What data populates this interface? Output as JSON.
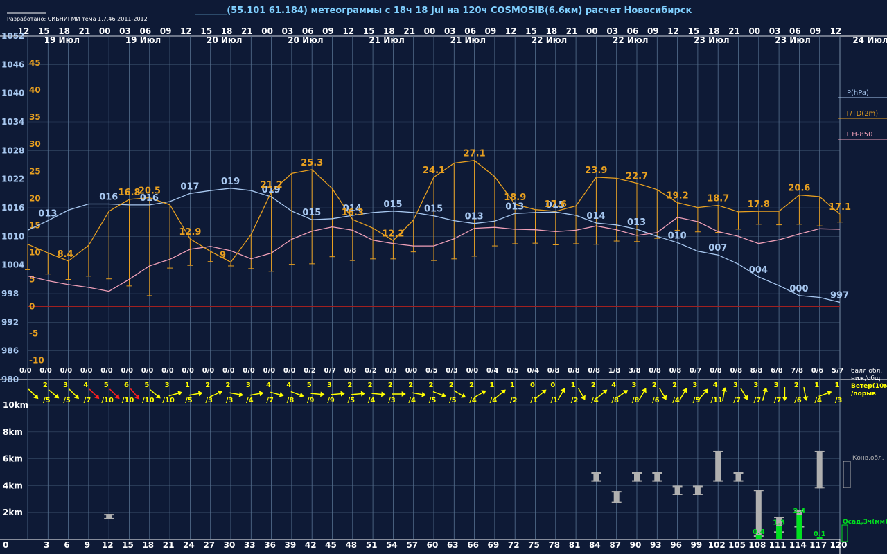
{
  "header": {
    "credit": "Разработано: СИБНИГМИ тема 1.7.46 2011-2012",
    "title": "_______(55.101 61.184) метеограммы с  18ч 18 Jul на 120ч COSMOSIB(6.6км) расчет Новосибирск"
  },
  "colors": {
    "background": "#0e1a36",
    "grid": "#56708f",
    "pressure": "#a8c8f0",
    "temperature": "#e8a020",
    "t850": "#f0a0b8",
    "wind": "#ffff00",
    "wind_strong": "#ff2020",
    "precip": "#00e020",
    "clouds": "#b0b0b0",
    "zero_line": "#a02020",
    "text_white": "#ffffff",
    "text_blue": "#a8c8f0"
  },
  "top_hours": [
    "12",
    "15",
    "18",
    "21",
    "00",
    "03",
    "06",
    "09",
    "12",
    "15",
    "18",
    "21",
    "00",
    "03",
    "06",
    "09",
    "12",
    "15",
    "18",
    "21",
    "00",
    "03",
    "06",
    "09",
    "12",
    "15",
    "18",
    "21",
    "00",
    "03",
    "06",
    "09",
    "12",
    "15",
    "18",
    "21",
    "00",
    "03",
    "06",
    "09",
    "12"
  ],
  "date_labels": [
    {
      "text": "19 Июл",
      "hour": 3
    },
    {
      "text": "19 Июл",
      "hour": 15
    },
    {
      "text": "20 Июл",
      "hour": 27
    },
    {
      "text": "20 Июл",
      "hour": 39
    },
    {
      "text": "21 Июл",
      "hour": 51
    },
    {
      "text": "21 Июл",
      "hour": 63
    },
    {
      "text": "22 Июл",
      "hour": 75
    },
    {
      "text": "22 Июл",
      "hour": 87
    },
    {
      "text": "23 Июл",
      "hour": 99
    },
    {
      "text": "23 Июл",
      "hour": 111
    }
  ],
  "date_label_right": "24 Июл",
  "legend": {
    "pressure": "P(hPa)",
    "temperature": "T/TD(2m)",
    "t850": "T H-850",
    "cloud_amount": "балл обл.\nниж/общ",
    "wind": "Ветер(10м\n/порыв",
    "conv_clouds": "Конв.обл.",
    "precip": "Осад,3ч(мм)"
  },
  "chart_data": {
    "type": "line",
    "x_label": "",
    "x": [
      0,
      3,
      6,
      9,
      12,
      15,
      18,
      21,
      24,
      27,
      30,
      33,
      36,
      39,
      42,
      45,
      48,
      51,
      54,
      57,
      60,
      63,
      66,
      69,
      72,
      75,
      78,
      81,
      84,
      87,
      90,
      93,
      96,
      99,
      102,
      105,
      108,
      111,
      114,
      117,
      120
    ],
    "x_ticks": [
      "0",
      "3",
      "6",
      "9",
      "12",
      "15",
      "18",
      "21",
      "24",
      "27",
      "30",
      "33",
      "36",
      "39",
      "42",
      "45",
      "48",
      "51",
      "54",
      "57",
      "60",
      "63",
      "66",
      "69",
      "72",
      "75",
      "78",
      "81",
      "84",
      "87",
      "90",
      "93",
      "96",
      "99",
      "102",
      "105",
      "108",
      "111",
      "114",
      "117",
      "120"
    ],
    "pressure_axis": {
      "ticks": [
        980,
        986,
        992,
        998,
        1004,
        1010,
        1016,
        1022,
        1028,
        1034,
        1040,
        1046,
        1052
      ],
      "range": [
        980,
        1052
      ]
    },
    "temperature_axis": {
      "ticks": [
        -10,
        -5,
        0,
        5,
        10,
        15,
        20,
        25,
        30,
        35,
        40,
        45
      ],
      "range": [
        -13.5,
        50
      ]
    },
    "series": [
      {
        "name": "P(hPa)",
        "axis": "pressure",
        "values": [
          1011.3,
          1013.3,
          1015.5,
          1016.8,
          1016.8,
          1016.6,
          1016.6,
          1017.3,
          1019.0,
          1019.6,
          1020.1,
          1019.6,
          1018.3,
          1015.3,
          1013.5,
          1013.7,
          1014.4,
          1015.0,
          1015.3,
          1015.0,
          1014.3,
          1013.3,
          1012.7,
          1013.2,
          1014.8,
          1015.0,
          1015.1,
          1014.4,
          1012.8,
          1012.4,
          1011.5,
          1010.0,
          1008.7,
          1006.9,
          1006.1,
          1004.2,
          1001.5,
          999.7,
          997.6,
          997.2,
          996.2
        ]
      },
      {
        "name": "T/TD(2m)",
        "axis": "temperature",
        "values": [
          11.5,
          9.9,
          8.4,
          11.3,
          17.6,
          19.8,
          20.1,
          18.8,
          12.5,
          10.2,
          8.2,
          13.3,
          21.2,
          24.6,
          25.3,
          21.8,
          16.1,
          14.5,
          12.2,
          16.0,
          23.9,
          26.5,
          27.0,
          24.0,
          18.9,
          17.9,
          17.6,
          18.6,
          23.9,
          23.7,
          22.8,
          21.6,
          19.2,
          18.3,
          18.7,
          17.5,
          17.6,
          17.6,
          20.6,
          20.3,
          17.1
        ]
      },
      {
        "name": "Td",
        "axis": "temperature",
        "values": [
          6.8,
          6.0,
          5.0,
          5.6,
          5.1,
          3.8,
          2.0,
          7.1,
          7.6,
          8.3,
          7.5,
          7.0,
          6.5,
          7.8,
          7.9,
          9.2,
          8.5,
          8.8,
          8.8,
          10.1,
          8.5,
          8.8,
          9.3,
          11.2,
          11.6,
          11.7,
          11.4,
          11.6,
          11.5,
          12.1,
          12.0,
          12.6,
          14.1,
          13.8,
          13.7,
          14.3,
          15.2,
          15.1,
          15.2,
          14.9,
          15.6
        ]
      },
      {
        "name": "T H-850",
        "axis": "pressure",
        "values": [
          1001.7,
          1000.7,
          999.9,
          999.3,
          998.5,
          1001.0,
          1003.8,
          1005.2,
          1007.3,
          1007.9,
          1007.0,
          1005.3,
          1006.5,
          1009.4,
          1011.1,
          1012.0,
          1011.3,
          1009.2,
          1008.5,
          1008.0,
          1008.0,
          1009.5,
          1011.7,
          1011.9,
          1011.5,
          1011.4,
          1011.0,
          1011.3,
          1012.2,
          1011.4,
          1010.2,
          1010.8,
          1014.0,
          1013.1,
          1011.0,
          1010.0,
          1008.5,
          1009.3,
          1010.5,
          1011.6,
          1011.5
        ]
      }
    ],
    "pressure_labels": [
      {
        "i": 1,
        "text": "013"
      },
      {
        "i": 4,
        "text": "016"
      },
      {
        "i": 6,
        "text": "016"
      },
      {
        "i": 8,
        "text": "017"
      },
      {
        "i": 10,
        "text": "019"
      },
      {
        "i": 12,
        "text": "019"
      },
      {
        "i": 14,
        "text": "015"
      },
      {
        "i": 16,
        "text": "014"
      },
      {
        "i": 18,
        "text": "015"
      },
      {
        "i": 20,
        "text": "015"
      },
      {
        "i": 22,
        "text": "013"
      },
      {
        "i": 24,
        "text": "013"
      },
      {
        "i": 26,
        "text": "015"
      },
      {
        "i": 28,
        "text": "014"
      },
      {
        "i": 30,
        "text": "013"
      },
      {
        "i": 32,
        "text": "010"
      },
      {
        "i": 34,
        "text": "007"
      },
      {
        "i": 36,
        "text": "004"
      },
      {
        "i": 38,
        "text": "000"
      },
      {
        "i": 40,
        "text": "997"
      }
    ],
    "temp_labels": [
      {
        "i": 2,
        "text": "8.4"
      },
      {
        "i": 5,
        "text": "16.8"
      },
      {
        "i": 6,
        "text": "20.5"
      },
      {
        "i": 8,
        "text": "12.9"
      },
      {
        "i": 10,
        "text": "9"
      },
      {
        "i": 12,
        "text": "21.2"
      },
      {
        "i": 14,
        "text": "25.3"
      },
      {
        "i": 16,
        "text": "16.3"
      },
      {
        "i": 18,
        "text": "12.2"
      },
      {
        "i": 20,
        "text": "24.1"
      },
      {
        "i": 22,
        "text": "27.1"
      },
      {
        "i": 24,
        "text": "18.9"
      },
      {
        "i": 26,
        "text": "17.6"
      },
      {
        "i": 28,
        "text": "23.9"
      },
      {
        "i": 30,
        "text": "22.7"
      },
      {
        "i": 32,
        "text": "19.2"
      },
      {
        "i": 34,
        "text": "18.7"
      },
      {
        "i": 36,
        "text": "17.8"
      },
      {
        "i": 38,
        "text": "20.6"
      },
      {
        "i": 40,
        "text": "17.1"
      }
    ],
    "cloud_amounts": [
      "0/0",
      "0/0",
      "0/0",
      "0/0",
      "0/0",
      "0/0",
      "0/0",
      "0/0",
      "0/0",
      "0/0",
      "0/0",
      "0/0",
      "0/0",
      "0/0",
      "0/2",
      "0/7",
      "0/8",
      "0/2",
      "0/3",
      "0/0",
      "0/5",
      "0/3",
      "0/0",
      "0/4",
      "0/5",
      "0/4",
      "0/8",
      "0/8",
      "0/8",
      "1/8",
      "3/8",
      "0/8",
      "0/8",
      "0/7",
      "0/8",
      "0/8",
      "8/8",
      "6/8",
      "7/8",
      "0/6",
      "5/7"
    ],
    "wind": [
      {
        "i": 1,
        "speed": "2",
        "gust": "/5",
        "dir": 45
      },
      {
        "i": 2,
        "speed": "3",
        "gust": "/5",
        "dir": 40
      },
      {
        "i": 3,
        "speed": "4",
        "gust": "/7",
        "dir": 45
      },
      {
        "i": 4,
        "speed": "5",
        "gust": "/10",
        "dir": 45,
        "strong": true
      },
      {
        "i": 5,
        "speed": "6",
        "gust": "/10",
        "dir": 45,
        "strong": true
      },
      {
        "i": 6,
        "speed": "5",
        "gust": "/10",
        "dir": 50,
        "strong": true
      },
      {
        "i": 7,
        "speed": "3",
        "gust": "/10",
        "dir": 40
      },
      {
        "i": 8,
        "speed": "1",
        "gust": "/5",
        "dir": -15
      },
      {
        "i": 9,
        "speed": "2",
        "gust": "/3",
        "dir": -10
      },
      {
        "i": 10,
        "speed": "2",
        "gust": "/3",
        "dir": -25
      },
      {
        "i": 11,
        "speed": "3",
        "gust": "/4",
        "dir": 10
      },
      {
        "i": 12,
        "speed": "4",
        "gust": "/7",
        "dir": -10
      },
      {
        "i": 13,
        "speed": "4",
        "gust": "/8",
        "dir": 15
      },
      {
        "i": 14,
        "speed": "5",
        "gust": "/9",
        "dir": 20
      },
      {
        "i": 15,
        "speed": "3",
        "gust": "/9",
        "dir": 5
      },
      {
        "i": 16,
        "speed": "2",
        "gust": "/5",
        "dir": -5
      },
      {
        "i": 17,
        "speed": "2",
        "gust": "/4",
        "dir": -5
      },
      {
        "i": 18,
        "speed": "2",
        "gust": "/3",
        "dir": 5
      },
      {
        "i": 19,
        "speed": "2",
        "gust": "/4",
        "dir": 0
      },
      {
        "i": 20,
        "speed": "2",
        "gust": "/5",
        "dir": 10
      },
      {
        "i": 21,
        "speed": "2",
        "gust": "/5",
        "dir": 20
      },
      {
        "i": 22,
        "speed": "2",
        "gust": "/4",
        "dir": 30
      },
      {
        "i": 23,
        "speed": "1",
        "gust": "/4",
        "dir": -30
      },
      {
        "i": 24,
        "speed": "1",
        "gust": "/2",
        "dir": -40
      },
      {
        "i": 25,
        "speed": "0",
        "gust": "/1",
        "dir": 0,
        "calm": true
      },
      {
        "i": 26,
        "speed": "0",
        "gust": "/1",
        "dir": -40
      },
      {
        "i": 27,
        "speed": "1",
        "gust": "/2",
        "dir": -60
      },
      {
        "i": 28,
        "speed": "2",
        "gust": "/4",
        "dir": 60
      },
      {
        "i": 29,
        "speed": "4",
        "gust": "/8",
        "dir": -40
      },
      {
        "i": 30,
        "speed": "3",
        "gust": "/8",
        "dir": -35
      },
      {
        "i": 31,
        "speed": "2",
        "gust": "/6",
        "dir": -60
      },
      {
        "i": 32,
        "speed": "2",
        "gust": "/4",
        "dir": 60
      },
      {
        "i": 33,
        "speed": "3",
        "gust": "/5",
        "dir": -60
      },
      {
        "i": 34,
        "speed": "4",
        "gust": "/11",
        "dir": -50
      },
      {
        "i": 35,
        "speed": "3",
        "gust": "/7",
        "dir": -80
      },
      {
        "i": 36,
        "speed": "3",
        "gust": "/7",
        "dir": 60
      },
      {
        "i": 37,
        "speed": "3",
        "gust": "/7",
        "dir": -75
      },
      {
        "i": 38,
        "speed": "2",
        "gust": "/6",
        "dir": 90
      },
      {
        "i": 39,
        "speed": "1",
        "gust": "/4",
        "dir": 80
      },
      {
        "i": 40,
        "speed": "1",
        "gust": "/3",
        "dir": -20
      }
    ],
    "height_axis": {
      "ticks": [
        "0",
        "2km",
        "4km",
        "6km",
        "8km",
        "10km"
      ],
      "range": [
        0,
        10
      ]
    },
    "conv_clouds": [
      {
        "i": 4,
        "base": 1.5,
        "top": 1.9
      },
      {
        "i": 28,
        "base": 4.3,
        "top": 5.0
      },
      {
        "i": 29,
        "base": 2.7,
        "top": 3.6
      },
      {
        "i": 30,
        "base": 4.3,
        "top": 5.0
      },
      {
        "i": 31,
        "base": 4.3,
        "top": 5.0
      },
      {
        "i": 32,
        "base": 3.3,
        "top": 4.0
      },
      {
        "i": 33,
        "base": 3.3,
        "top": 4.0
      },
      {
        "i": 34,
        "base": 4.3,
        "top": 6.6
      },
      {
        "i": 35,
        "base": 4.3,
        "top": 5.0
      },
      {
        "i": 36,
        "base": 0.2,
        "top": 3.7
      },
      {
        "i": 37,
        "base": 0.5,
        "top": 1.7
      },
      {
        "i": 38,
        "base": 0.9,
        "top": 2.2
      },
      {
        "i": 39,
        "base": 3.8,
        "top": 6.6
      }
    ],
    "precip": [
      {
        "i": 36,
        "value": 0.4,
        "label": "0.4"
      },
      {
        "i": 37,
        "value": 1.3,
        "label": "1.3"
      },
      {
        "i": 38,
        "value": 2.4,
        "label": "2.4"
      },
      {
        "i": 39,
        "value": 0.1,
        "label": "0.1"
      }
    ]
  }
}
